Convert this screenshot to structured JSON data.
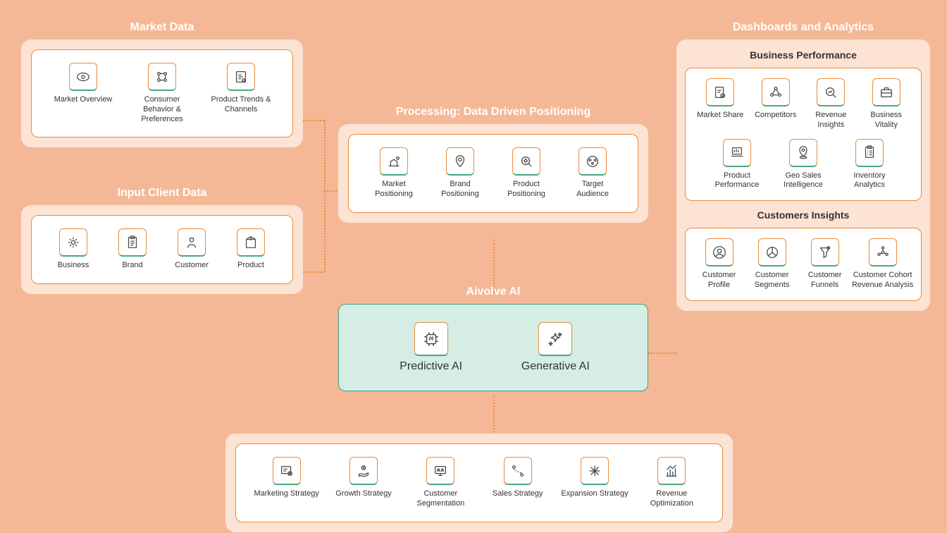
{
  "market": {
    "title": "Market Data",
    "items": [
      {
        "label": "Market Overview",
        "icon": "eye-icon"
      },
      {
        "label": "Consumer Behavior & Preferences",
        "icon": "grid-people-icon"
      },
      {
        "label": "Product Trends & Channels",
        "icon": "report-icon"
      }
    ]
  },
  "input": {
    "title": "Input Client Data",
    "items": [
      {
        "label": "Business",
        "icon": "gear-icon"
      },
      {
        "label": "Brand",
        "icon": "clipboard-icon"
      },
      {
        "label": "Customer",
        "icon": "person-icon"
      },
      {
        "label": "Product",
        "icon": "box-icon"
      }
    ]
  },
  "processing": {
    "title": "Processing: Data Driven Positioning",
    "items": [
      {
        "label": "Market Positioning",
        "icon": "market-pos-icon"
      },
      {
        "label": "Brand Positioning",
        "icon": "pin-shield-icon"
      },
      {
        "label": "Product Positioning",
        "icon": "magnify-gear-icon"
      },
      {
        "label": "Target Audience",
        "icon": "target-people-icon"
      }
    ]
  },
  "ai": {
    "title": "Aivolve AI",
    "items": [
      {
        "label": "Predictive AI",
        "icon": "ai-chip-icon"
      },
      {
        "label": "Generative AI",
        "icon": "sparkles-icon"
      }
    ]
  },
  "strategy": {
    "items": [
      {
        "label": "Marketing Strategy",
        "icon": "doc-target-icon"
      },
      {
        "label": "Growth Strategy",
        "icon": "hand-coin-icon"
      },
      {
        "label": "Customer Segmentation",
        "icon": "screen-people-icon"
      },
      {
        "label": "Sales Strategy",
        "icon": "path-icon"
      },
      {
        "label": "Expansion Strategy",
        "icon": "expand-icon"
      },
      {
        "label": "Revenue Optimization",
        "icon": "bar-chart-icon"
      }
    ]
  },
  "dashboards": {
    "title": "Dashboards and Analytics",
    "business": {
      "title": "Business Performance",
      "row1": [
        {
          "label": "Market Share",
          "icon": "doc-check-icon"
        },
        {
          "label": "Competitors",
          "icon": "network-nodes-icon"
        },
        {
          "label": "Revenue Insights",
          "icon": "magnify-chart-icon"
        },
        {
          "label": "Business Vitality",
          "icon": "briefcase-icon"
        }
      ],
      "row2": [
        {
          "label": "Product Performance",
          "icon": "laptop-stats-icon"
        },
        {
          "label": "Geo Sales Intelligence",
          "icon": "geo-pin-icon"
        },
        {
          "label": "Inventory Analytics",
          "icon": "clipboard-list-icon"
        }
      ]
    },
    "customers": {
      "title": "Customers Insights",
      "items": [
        {
          "label": "Customer Profile",
          "icon": "user-circle-icon"
        },
        {
          "label": "Customer Segments",
          "icon": "pie-users-icon"
        },
        {
          "label": "Customer Funnels",
          "icon": "funnel-icon"
        },
        {
          "label": "Customer Cohort Revenue Analysis",
          "icon": "cohort-icon"
        }
      ]
    }
  }
}
